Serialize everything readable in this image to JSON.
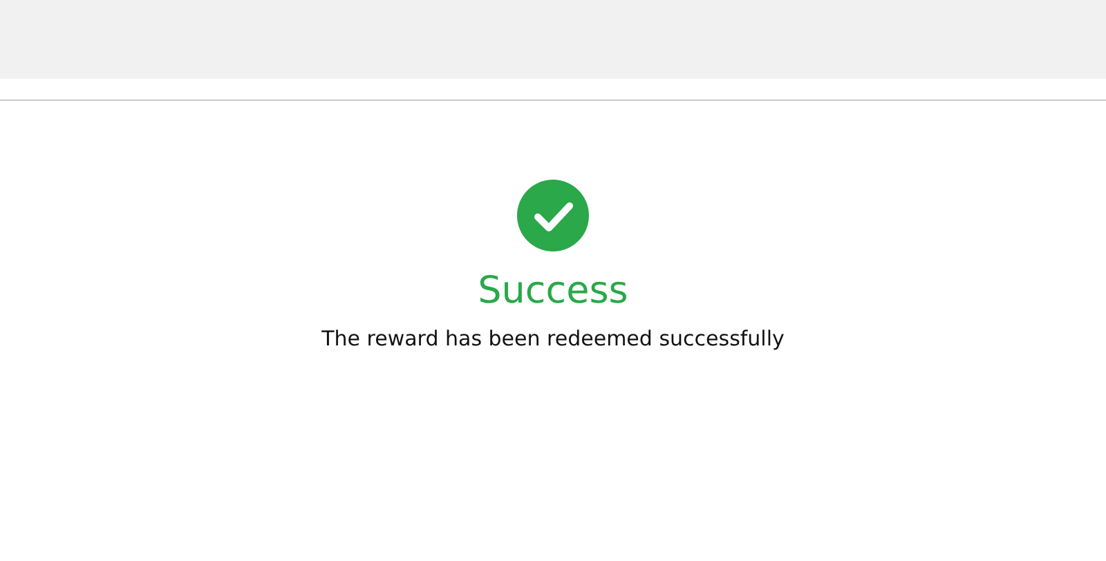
{
  "result": {
    "kind": "success",
    "title": "Success",
    "message": "The reward has been redeemed successfully"
  }
}
